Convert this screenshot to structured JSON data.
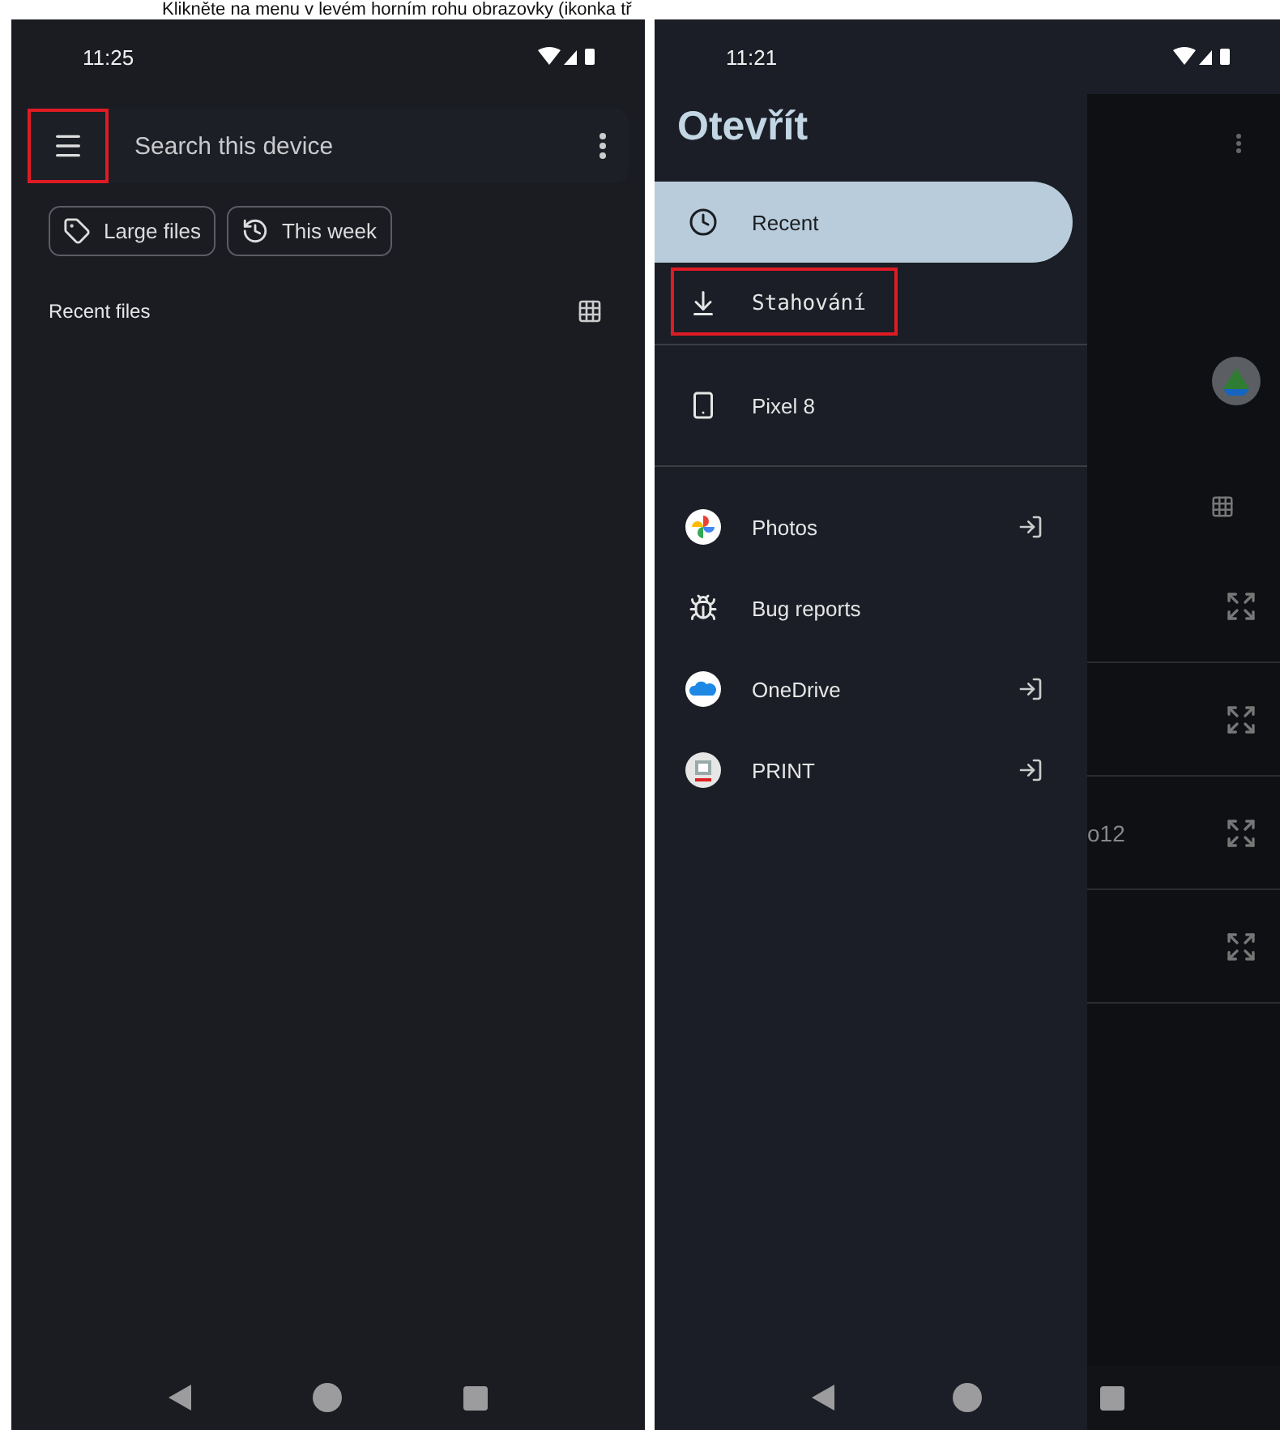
{
  "caption": "Klikněte na menu v levém horním rohu obrazovky (ikonka tř",
  "left_screen": {
    "time": "11:25",
    "menu_button": {
      "highlighted": true
    },
    "search": {
      "placeholder": "Search this device"
    },
    "chips": [
      {
        "kind": "tag",
        "label": "Large files"
      },
      {
        "kind": "history",
        "label": "This week"
      }
    ],
    "section_title": "Recent files"
  },
  "right_screen": {
    "time": "11:21",
    "drawer_title": "Otevřít",
    "drawer_groups": [
      {
        "items": [
          {
            "kind": "clock",
            "label": "Recent",
            "selected": true,
            "highlighted": false,
            "eject": false
          },
          {
            "kind": "download",
            "label": "Stahování",
            "selected": false,
            "highlighted": true,
            "eject": false
          }
        ]
      },
      {
        "items": [
          {
            "kind": "phone",
            "label": "Pixel 8",
            "selected": false,
            "highlighted": false,
            "eject": false
          }
        ]
      },
      {
        "items": [
          {
            "kind": "photos",
            "label": "Photos",
            "selected": false,
            "highlighted": false,
            "eject": true
          },
          {
            "kind": "bug",
            "label": "Bug reports",
            "selected": false,
            "highlighted": false,
            "eject": false
          },
          {
            "kind": "cloud",
            "label": "OneDrive",
            "selected": false,
            "highlighted": false,
            "eject": true
          },
          {
            "kind": "printer",
            "label": "PRINT",
            "selected": false,
            "highlighted": false,
            "eject": true
          }
        ]
      }
    ],
    "background_text": "o12"
  }
}
